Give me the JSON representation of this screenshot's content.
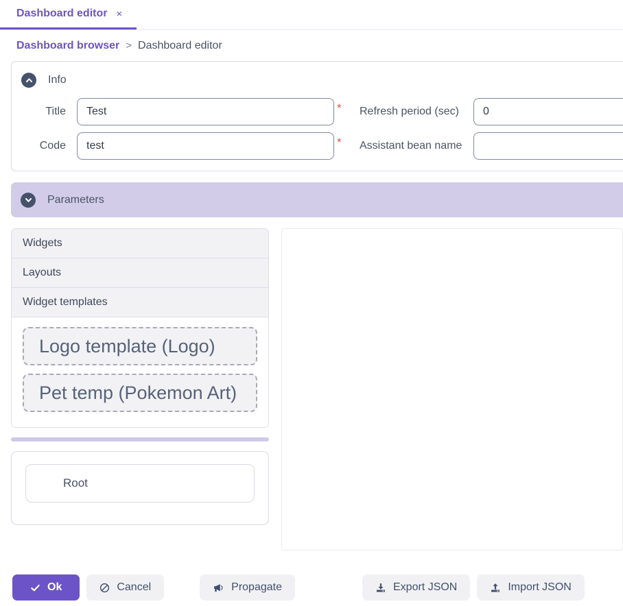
{
  "tab": {
    "label": "Dashboard editor",
    "close_icon": "close-icon",
    "close_glyph": "×",
    "accent_color": "#6c54c8"
  },
  "breadcrumb": {
    "parent": "Dashboard browser",
    "separator": ">",
    "current": "Dashboard editor"
  },
  "info_section": {
    "title": "Info",
    "collapse_icon": "chevron-up-circle-icon",
    "expanded": true,
    "fields": {
      "title_label": "Title",
      "title_value": "Test",
      "title_required": "*",
      "code_label": "Code",
      "code_value": "test",
      "code_required": "*",
      "refresh_label": "Refresh period (sec)",
      "refresh_value": "0",
      "assistant_label": "Assistant bean name",
      "assistant_value": ""
    }
  },
  "parameters_section": {
    "title": "Parameters",
    "expand_icon": "chevron-down-circle-icon",
    "expanded": false,
    "background_color": "#d2cce9"
  },
  "palette": {
    "accordion": [
      {
        "label": "Widgets",
        "expanded": false
      },
      {
        "label": "Layouts",
        "expanded": false
      },
      {
        "label": "Widget templates",
        "expanded": true
      }
    ],
    "widget_templates": [
      "Logo template (Logo)",
      "Pet temp (Pokemon Art)"
    ]
  },
  "splitter": {
    "name": "panel-splitter",
    "color": "#cfc8e8"
  },
  "tree": {
    "root_label": "Root"
  },
  "canvas": {
    "content": ""
  },
  "footer": {
    "buttons": [
      {
        "label": "Ok",
        "icon": "check-icon",
        "variant": "primary"
      },
      {
        "label": "Cancel",
        "icon": "ban-icon",
        "variant": "default"
      },
      {
        "label": "Propagate",
        "icon": "bullhorn-icon",
        "variant": "default"
      },
      {
        "label": "Export JSON",
        "icon": "download-icon",
        "variant": "default"
      },
      {
        "label": "Import JSON",
        "icon": "upload-icon",
        "variant": "default"
      }
    ]
  }
}
